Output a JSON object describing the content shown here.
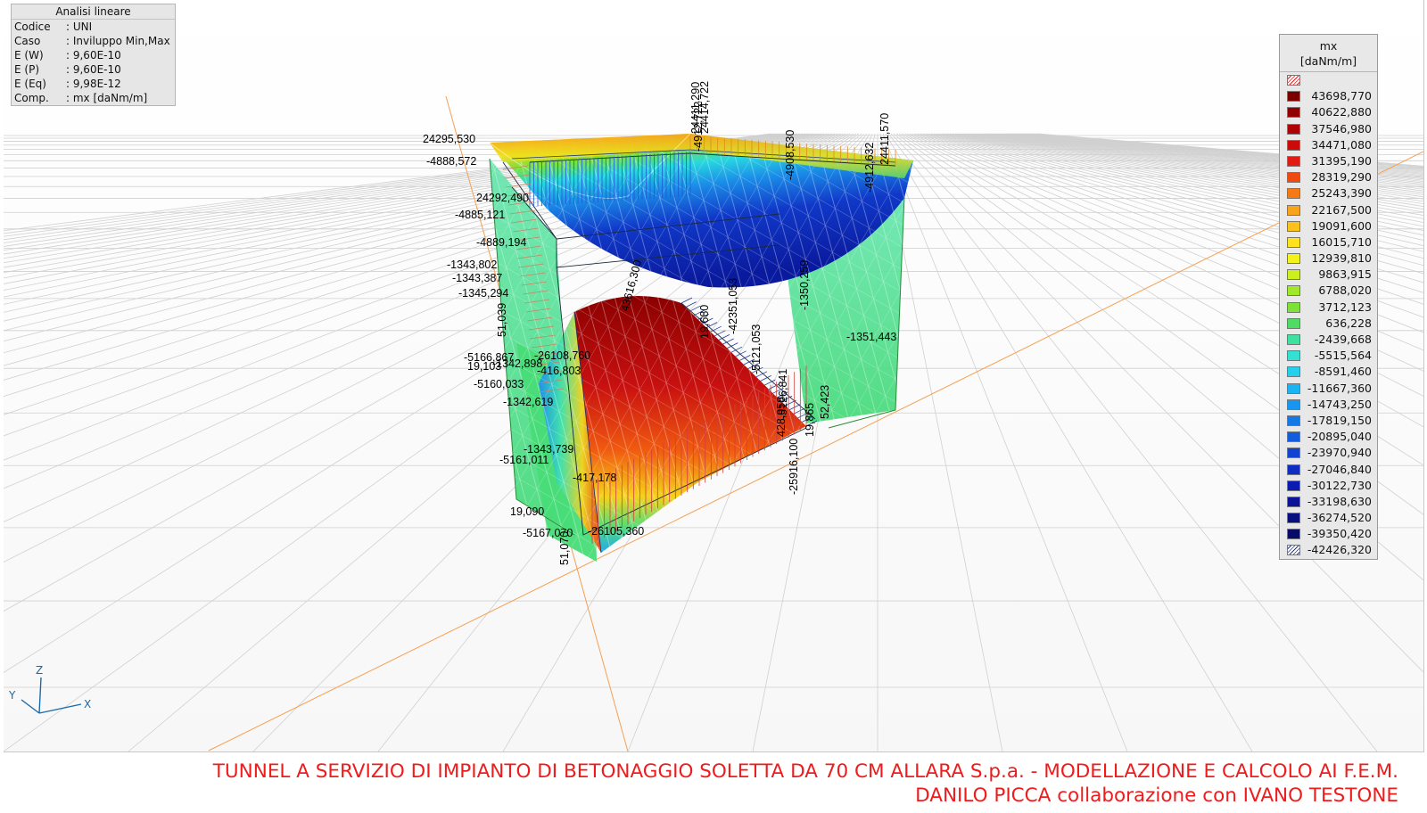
{
  "info_panel": {
    "title": "Analisi lineare",
    "rows": [
      {
        "key": "Codice",
        "value": ": UNI"
      },
      {
        "key": "Caso",
        "value": ": Inviluppo Min,Max"
      },
      {
        "key": "E (W)",
        "value": ": 9,60E-10"
      },
      {
        "key": "E (P)",
        "value": ": 9,60E-10"
      },
      {
        "key": "E (Eq)",
        "value": ": 9,98E-12"
      },
      {
        "key": "Comp.",
        "value": ": mx [daNm/m]"
      }
    ]
  },
  "legend": {
    "title": "mx",
    "unit": "[daNm/m]",
    "entries": [
      {
        "value": "43698,770",
        "color": "#7a0000"
      },
      {
        "value": "40622,880",
        "color": "#930000"
      },
      {
        "value": "37546,980",
        "color": "#b00404"
      },
      {
        "value": "34471,080",
        "color": "#cc0a0a"
      },
      {
        "value": "31395,190",
        "color": "#e31a10"
      },
      {
        "value": "28319,290",
        "color": "#f04a10"
      },
      {
        "value": "25243,390",
        "color": "#f57a14"
      },
      {
        "value": "22167,500",
        "color": "#f9a21c"
      },
      {
        "value": "19091,600",
        "color": "#fcc21c"
      },
      {
        "value": "16015,710",
        "color": "#fee21c"
      },
      {
        "value": "12939,810",
        "color": "#f2f21c"
      },
      {
        "value": "9863,915",
        "color": "#ccef1e"
      },
      {
        "value": "6788,020",
        "color": "#a2e82a"
      },
      {
        "value": "3712,123",
        "color": "#7ce23a"
      },
      {
        "value": "636,228",
        "color": "#4fdc64"
      },
      {
        "value": "-2439,668",
        "color": "#3fe0a0"
      },
      {
        "value": "-5515,564",
        "color": "#33e0d2"
      },
      {
        "value": "-8591,460",
        "color": "#25cfee"
      },
      {
        "value": "-11667,360",
        "color": "#1ab4f2"
      },
      {
        "value": "-14743,250",
        "color": "#1696ee"
      },
      {
        "value": "-17819,150",
        "color": "#1478e6"
      },
      {
        "value": "-20895,040",
        "color": "#125ddc"
      },
      {
        "value": "-23970,940",
        "color": "#1044d0"
      },
      {
        "value": "-27046,840",
        "color": "#0e2dc2"
      },
      {
        "value": "-30122,730",
        "color": "#0c1cb0"
      },
      {
        "value": "-33198,630",
        "color": "#0a1496"
      },
      {
        "value": "-36274,520",
        "color": "#080f7e"
      },
      {
        "value": "-39350,420",
        "color": "#060b66"
      }
    ],
    "top_hatch_color": "#d22222",
    "bottom_hatch_value": "-42426,320",
    "bottom_hatch_color": "#1a3aa8"
  },
  "axes": {
    "x": "X",
    "y": "Y",
    "z": "Z"
  },
  "plot_labels": {
    "l01": "24295,530",
    "l02": "-4888,572",
    "l03": "24292,490",
    "l04": "-4885,121",
    "l05": "-4889,194",
    "l06": "-1343,802",
    "l07": "-1343,387",
    "l08": "-1345,294",
    "l09": "51,039",
    "l10": "-5166,867",
    "l11": "19,103",
    "l12": "-1342,898",
    "l13": "-26108,760",
    "l14": "-416,803",
    "l15": "-5160,033",
    "l16": "-1342,619",
    "l17": "-1343,739",
    "l18": "-5161,011",
    "l19": "-417,178",
    "l20": "19,090",
    "l21": "-5167,070",
    "l22": "51,070",
    "l23": "-26105,360",
    "l24": "-1351,443",
    "l25": "52,423",
    "l26": "-25916,100",
    "l27": "-1350,259",
    "l28": "-42351,053",
    "l29": "-5121,053",
    "l30": "-5126,841",
    "l31": "-4908,530",
    "l32": "-4912,632",
    "l33": "24411,570",
    "l34": "24411,290",
    "l35": "24414,722",
    "l36": "-4912,722",
    "l37": "19,680",
    "l38": "428,958",
    "l39": "19,865",
    "l40": "43616,300"
  },
  "footer": {
    "line1": "TUNNEL A SERVIZIO DI IMPIANTO DI BETONAGGIO SOLETTA DA 70 CM ALLARA S.p.a. - MODELLAZIONE E CALCOLO AI F.E.M.",
    "line2": "DANILO PICCA collaborazione con IVANO TESTONE",
    "color": "#ee1c1c"
  }
}
